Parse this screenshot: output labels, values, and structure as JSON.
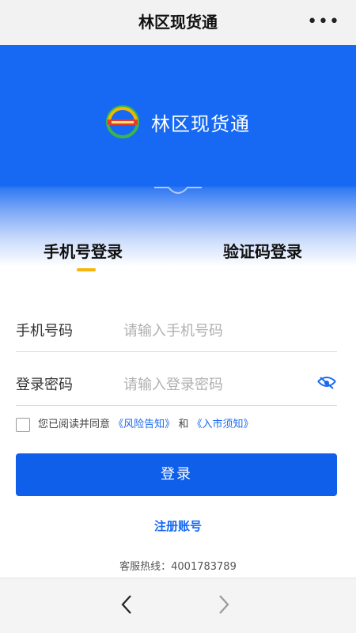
{
  "topbar": {
    "title": "林区现货通",
    "more_label": "•••"
  },
  "banner": {
    "brand_name": "林区现货通",
    "logo_icon": "forest-globe-logo-icon"
  },
  "tabs": [
    {
      "label": "手机号登录",
      "active": true
    },
    {
      "label": "验证码登录",
      "active": false
    }
  ],
  "form": {
    "phone": {
      "label": "手机号码",
      "placeholder": "请输入手机号码",
      "value": ""
    },
    "password": {
      "label": "登录密码",
      "placeholder": "请输入登录密码",
      "value": "",
      "toggle_icon": "eye-hidden-icon"
    }
  },
  "agreement": {
    "checked": false,
    "prefix": "您已阅读并同意",
    "link1": "《风险告知》",
    "middle": "和",
    "link2": "《入市须知》"
  },
  "login_button": "登录",
  "register_link": "注册账号",
  "hotline": "客服热线：4001783789",
  "colors": {
    "primary_blue": "#1769f3",
    "button_blue": "#0f5fea",
    "tab_indicator": "#f5b50a"
  },
  "bottom_nav": {
    "back_icon": "chevron-left-icon",
    "forward_icon": "chevron-right-icon"
  }
}
